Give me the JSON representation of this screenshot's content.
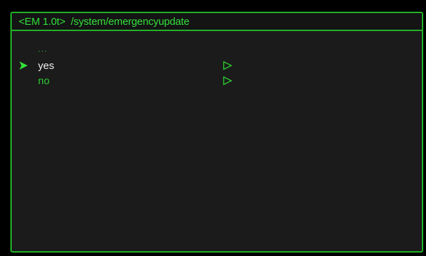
{
  "window": {
    "version": "<EM 1.0t>",
    "path": "/system/emergencyupdate"
  },
  "menu": {
    "parent": "...",
    "items": [
      {
        "label": "yes",
        "selected": true,
        "icon": "play-outline-icon"
      },
      {
        "label": "no",
        "selected": false,
        "icon": "play-outline-icon"
      }
    ]
  },
  "colors": {
    "accent": "#22b427",
    "text_green": "#2bcb31",
    "selected_text": "#f2f2f2",
    "background": "#1b1b1b"
  }
}
